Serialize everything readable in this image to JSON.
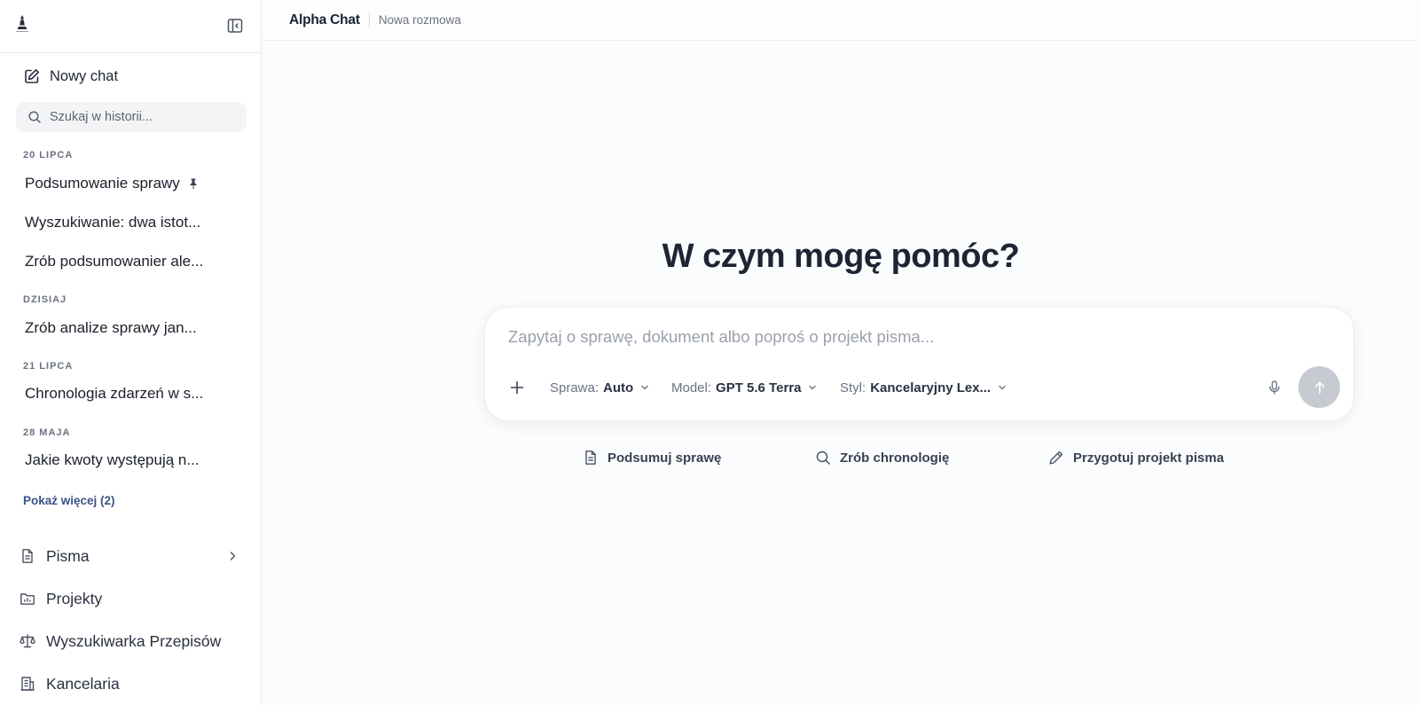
{
  "header": {
    "app_title": "Alpha Chat",
    "subtitle": "Nowa rozmowa"
  },
  "sidebar": {
    "logo_icon": "lady-justice-logo",
    "collapse_icon": "sidebar-collapse-icon",
    "new_chat": {
      "label": "Nowy chat",
      "icon": "edit-icon"
    },
    "search": {
      "placeholder": "Szukaj w historii...",
      "value": ""
    },
    "history": [
      {
        "group": "20 LIPCA",
        "items": [
          {
            "title": "Podsumowanie sprawy",
            "pinned": true
          },
          {
            "title": "Wyszukiwanie: dwa istot..."
          },
          {
            "title": "Zrób podsumowanier ale..."
          }
        ]
      },
      {
        "group": "DZISIAJ",
        "items": [
          {
            "title": "Zrób analize sprawy jan..."
          }
        ]
      },
      {
        "group": "21 LIPCA",
        "items": [
          {
            "title": "Chronologia zdarzeń w s..."
          }
        ]
      },
      {
        "group": "28 MAJA",
        "items": [
          {
            "title": "Jakie kwoty występują n..."
          }
        ]
      }
    ],
    "show_more": "Pokaż więcej (2)",
    "nav": [
      {
        "label": "Pisma",
        "icon": "document-icon",
        "has_chevron": true
      },
      {
        "label": "Projekty",
        "icon": "folder-chart-icon"
      },
      {
        "label": "Wyszukiwarka Przepisów",
        "icon": "scales-icon"
      },
      {
        "label": "Kancelaria",
        "icon": "building-icon"
      }
    ]
  },
  "main": {
    "heading": "W czym mogę pomóc?",
    "composer": {
      "placeholder": "Zapytaj o sprawę, dokument albo poproś o projekt pisma...",
      "value": "",
      "options": [
        {
          "key": "Sprawa:",
          "value": "Auto"
        },
        {
          "key": "Model:",
          "value": "GPT 5.6 Terra"
        },
        {
          "key": "Styl:",
          "value": "Kancelaryjny Lex..."
        }
      ]
    },
    "suggestions": [
      {
        "label": "Podsumuj sprawę",
        "icon": "file-text-icon"
      },
      {
        "label": "Zrób chronologię",
        "icon": "search-icon"
      },
      {
        "label": "Przygotuj projekt pisma",
        "icon": "pencil-icon"
      }
    ]
  },
  "colors": {
    "accent_link": "#3b5384",
    "send_disabled": "#c7cad1",
    "background": "#fbfcfd"
  }
}
